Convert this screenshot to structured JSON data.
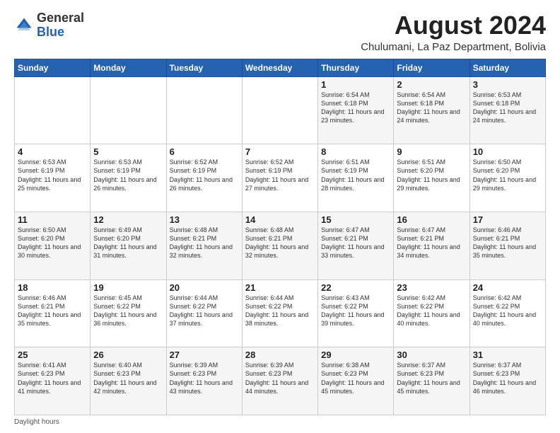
{
  "logo": {
    "general": "General",
    "blue": "Blue"
  },
  "header": {
    "month": "August 2024",
    "location": "Chulumani, La Paz Department, Bolivia"
  },
  "days_of_week": [
    "Sunday",
    "Monday",
    "Tuesday",
    "Wednesday",
    "Thursday",
    "Friday",
    "Saturday"
  ],
  "weeks": [
    [
      {
        "day": "",
        "info": ""
      },
      {
        "day": "",
        "info": ""
      },
      {
        "day": "",
        "info": ""
      },
      {
        "day": "",
        "info": ""
      },
      {
        "day": "1",
        "info": "Sunrise: 6:54 AM\nSunset: 6:18 PM\nDaylight: 11 hours\nand 23 minutes."
      },
      {
        "day": "2",
        "info": "Sunrise: 6:54 AM\nSunset: 6:18 PM\nDaylight: 11 hours\nand 24 minutes."
      },
      {
        "day": "3",
        "info": "Sunrise: 6:53 AM\nSunset: 6:18 PM\nDaylight: 11 hours\nand 24 minutes."
      }
    ],
    [
      {
        "day": "4",
        "info": "Sunrise: 6:53 AM\nSunset: 6:19 PM\nDaylight: 11 hours\nand 25 minutes."
      },
      {
        "day": "5",
        "info": "Sunrise: 6:53 AM\nSunset: 6:19 PM\nDaylight: 11 hours\nand 26 minutes."
      },
      {
        "day": "6",
        "info": "Sunrise: 6:52 AM\nSunset: 6:19 PM\nDaylight: 11 hours\nand 26 minutes."
      },
      {
        "day": "7",
        "info": "Sunrise: 6:52 AM\nSunset: 6:19 PM\nDaylight: 11 hours\nand 27 minutes."
      },
      {
        "day": "8",
        "info": "Sunrise: 6:51 AM\nSunset: 6:19 PM\nDaylight: 11 hours\nand 28 minutes."
      },
      {
        "day": "9",
        "info": "Sunrise: 6:51 AM\nSunset: 6:20 PM\nDaylight: 11 hours\nand 29 minutes."
      },
      {
        "day": "10",
        "info": "Sunrise: 6:50 AM\nSunset: 6:20 PM\nDaylight: 11 hours\nand 29 minutes."
      }
    ],
    [
      {
        "day": "11",
        "info": "Sunrise: 6:50 AM\nSunset: 6:20 PM\nDaylight: 11 hours\nand 30 minutes."
      },
      {
        "day": "12",
        "info": "Sunrise: 6:49 AM\nSunset: 6:20 PM\nDaylight: 11 hours\nand 31 minutes."
      },
      {
        "day": "13",
        "info": "Sunrise: 6:48 AM\nSunset: 6:21 PM\nDaylight: 11 hours\nand 32 minutes."
      },
      {
        "day": "14",
        "info": "Sunrise: 6:48 AM\nSunset: 6:21 PM\nDaylight: 11 hours\nand 32 minutes."
      },
      {
        "day": "15",
        "info": "Sunrise: 6:47 AM\nSunset: 6:21 PM\nDaylight: 11 hours\nand 33 minutes."
      },
      {
        "day": "16",
        "info": "Sunrise: 6:47 AM\nSunset: 6:21 PM\nDaylight: 11 hours\nand 34 minutes."
      },
      {
        "day": "17",
        "info": "Sunrise: 6:46 AM\nSunset: 6:21 PM\nDaylight: 11 hours\nand 35 minutes."
      }
    ],
    [
      {
        "day": "18",
        "info": "Sunrise: 6:46 AM\nSunset: 6:21 PM\nDaylight: 11 hours\nand 35 minutes."
      },
      {
        "day": "19",
        "info": "Sunrise: 6:45 AM\nSunset: 6:22 PM\nDaylight: 11 hours\nand 36 minutes."
      },
      {
        "day": "20",
        "info": "Sunrise: 6:44 AM\nSunset: 6:22 PM\nDaylight: 11 hours\nand 37 minutes."
      },
      {
        "day": "21",
        "info": "Sunrise: 6:44 AM\nSunset: 6:22 PM\nDaylight: 11 hours\nand 38 minutes."
      },
      {
        "day": "22",
        "info": "Sunrise: 6:43 AM\nSunset: 6:22 PM\nDaylight: 11 hours\nand 39 minutes."
      },
      {
        "day": "23",
        "info": "Sunrise: 6:42 AM\nSunset: 6:22 PM\nDaylight: 11 hours\nand 40 minutes."
      },
      {
        "day": "24",
        "info": "Sunrise: 6:42 AM\nSunset: 6:22 PM\nDaylight: 11 hours\nand 40 minutes."
      }
    ],
    [
      {
        "day": "25",
        "info": "Sunrise: 6:41 AM\nSunset: 6:23 PM\nDaylight: 11 hours\nand 41 minutes."
      },
      {
        "day": "26",
        "info": "Sunrise: 6:40 AM\nSunset: 6:23 PM\nDaylight: 11 hours\nand 42 minutes."
      },
      {
        "day": "27",
        "info": "Sunrise: 6:39 AM\nSunset: 6:23 PM\nDaylight: 11 hours\nand 43 minutes."
      },
      {
        "day": "28",
        "info": "Sunrise: 6:39 AM\nSunset: 6:23 PM\nDaylight: 11 hours\nand 44 minutes."
      },
      {
        "day": "29",
        "info": "Sunrise: 6:38 AM\nSunset: 6:23 PM\nDaylight: 11 hours\nand 45 minutes."
      },
      {
        "day": "30",
        "info": "Sunrise: 6:37 AM\nSunset: 6:23 PM\nDaylight: 11 hours\nand 45 minutes."
      },
      {
        "day": "31",
        "info": "Sunrise: 6:37 AM\nSunset: 6:23 PM\nDaylight: 11 hours\nand 46 minutes."
      }
    ]
  ],
  "footer": {
    "note": "Daylight hours"
  }
}
